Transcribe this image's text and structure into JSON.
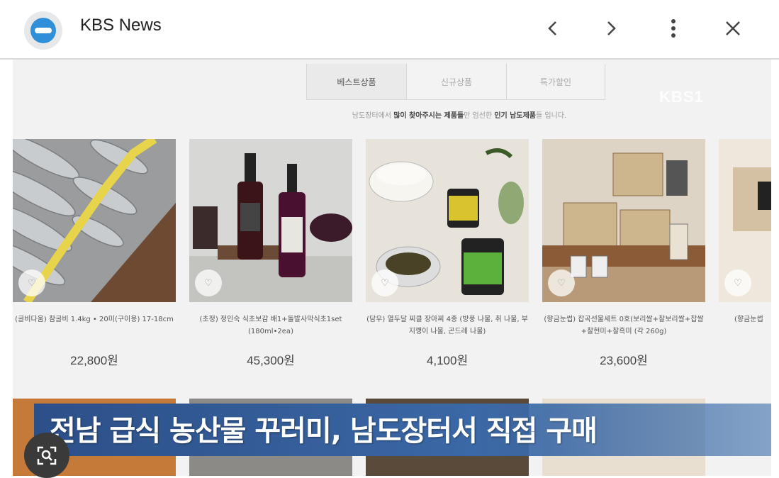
{
  "app": {
    "title": "KBS News"
  },
  "toolbar": {
    "back_icon": "chevron-left-icon",
    "forward_icon": "chevron-right-icon",
    "more_icon": "more-vertical-icon",
    "close_icon": "close-icon"
  },
  "video": {
    "watermark": "KBS1",
    "tabs": [
      "베스트상품",
      "신규상품",
      "특가할인"
    ],
    "subtitle": {
      "pre": "남도장터에서 ",
      "b1": "많이 찾아주시는 제품들",
      "mid": "만 엄선한 ",
      "b2": "인기 남도제품",
      "post": "들 입니다."
    },
    "products": [
      {
        "name": "(굴비다움) 참굴비 1.4kg • 20미(구이용) 17-18cm",
        "price": "22,800원"
      },
      {
        "name": "(초정) 정인숙 식초보감 배1+돌발사막식초1set (180ml•2ea)",
        "price": "45,300원"
      },
      {
        "name": "(담우) 열두달 찌클 장아찌 4종 (방풍 나물, 취 나물, 부지깽이 나물, 곤드레 나물)",
        "price": "4,100원"
      },
      {
        "name": "(향금눈썹) 잡곡선물세트 0호(보리쌀+찰보리쌀+찹쌀+찰현미+찰흑미 (각 260g)",
        "price": "23,600원"
      },
      {
        "name": "(향금눈썹",
        "price": ""
      }
    ],
    "caption": "전남 급식 농산물 꾸러미, 남도장터서 직접 구매"
  },
  "lens": {
    "icon": "lens-search-icon"
  },
  "colors": {
    "caption_bg": "#2c4f88",
    "logo_blue": "#2f8fd8"
  }
}
